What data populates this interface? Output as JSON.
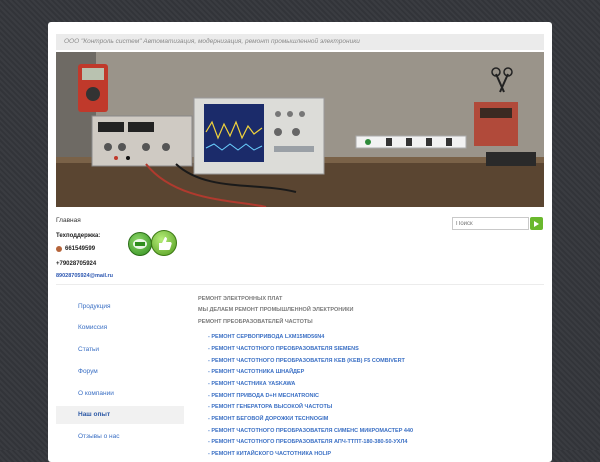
{
  "header": {
    "tagline": "ООО \"Контроль систем\" Автоматизация, модернизация, ремонт промышленной электроники"
  },
  "nav": {
    "home": "Главная"
  },
  "contacts": {
    "support_label": "Техподдержка:",
    "skype": "661549599",
    "phone": "+79028705924",
    "email": "89028705924@mail.ru"
  },
  "search": {
    "placeholder": "Поиск"
  },
  "sidebar": {
    "items": [
      {
        "label": "Продукция"
      },
      {
        "label": "Комиссия"
      },
      {
        "label": "Статьи"
      },
      {
        "label": "Форум"
      },
      {
        "label": "О компании"
      },
      {
        "label": "Наш опыт",
        "active": true
      },
      {
        "label": "Отзывы о нас"
      }
    ]
  },
  "content": {
    "categories": [
      "РЕМОНТ ЭЛЕКТРОННЫХ ПЛАТ",
      "МЫ ДЕЛАЕМ РЕМОНТ ПРОМЫШЛЕННОЙ ЭЛЕКТРОНИКИ",
      "РЕМОНТ ПРЕОБРАЗОВАТЕЛЕЙ ЧАСТОТЫ"
    ],
    "links": [
      "- РЕМОНТ СЕРВОПРИВОДА LXM15MD56N4",
      "- РЕМОНТ ЧАСТОТНОГО ПРЕОБРАЗОВАТЕЛЯ SIEMENS",
      "- РЕМОНТ ЧАСТОТНОГО ПРЕОБРАЗОВАТЕЛЯ KEB (KEB) F5 COMBIVERT",
      "- РЕМОНТ ЧАСТОТНИКА ШНАЙДЕР",
      "- РЕМОНТ ЧАСТНИКА YASKAWA",
      "- РЕМОНТ ПРИВОДА D+H MECHATRONIC",
      "- РЕМОНТ ГЕНЕРАТОРА ВЫСОКОЙ ЧАСТОТЫ",
      "- РЕМОНТ БЕГОВОЙ ДОРОЖКИ TECHNOGIM",
      "- РЕМОНТ ЧАСТОТНОГО ПРЕОБРАЗОВАТЕЛЯ СИМЕНС МИКРОМАСТЕР 440",
      "- РЕМОНТ ЧАСТОТНОГО ПРЕОБРАЗОВАТЕЛЯ АПЧ-ТТПТ-180-380-50-УХЛ4",
      "- РЕМОНТ КИТАЙСКОГО ЧАСТОТНИКА HOLIP"
    ]
  },
  "colors": {
    "background": "#34363b",
    "link": "#3a6fc4",
    "accent_green": "#6ab82d"
  },
  "icons": [
    "skype-icon",
    "green-badge-icon",
    "thumbs-up-icon",
    "search-go-icon"
  ]
}
